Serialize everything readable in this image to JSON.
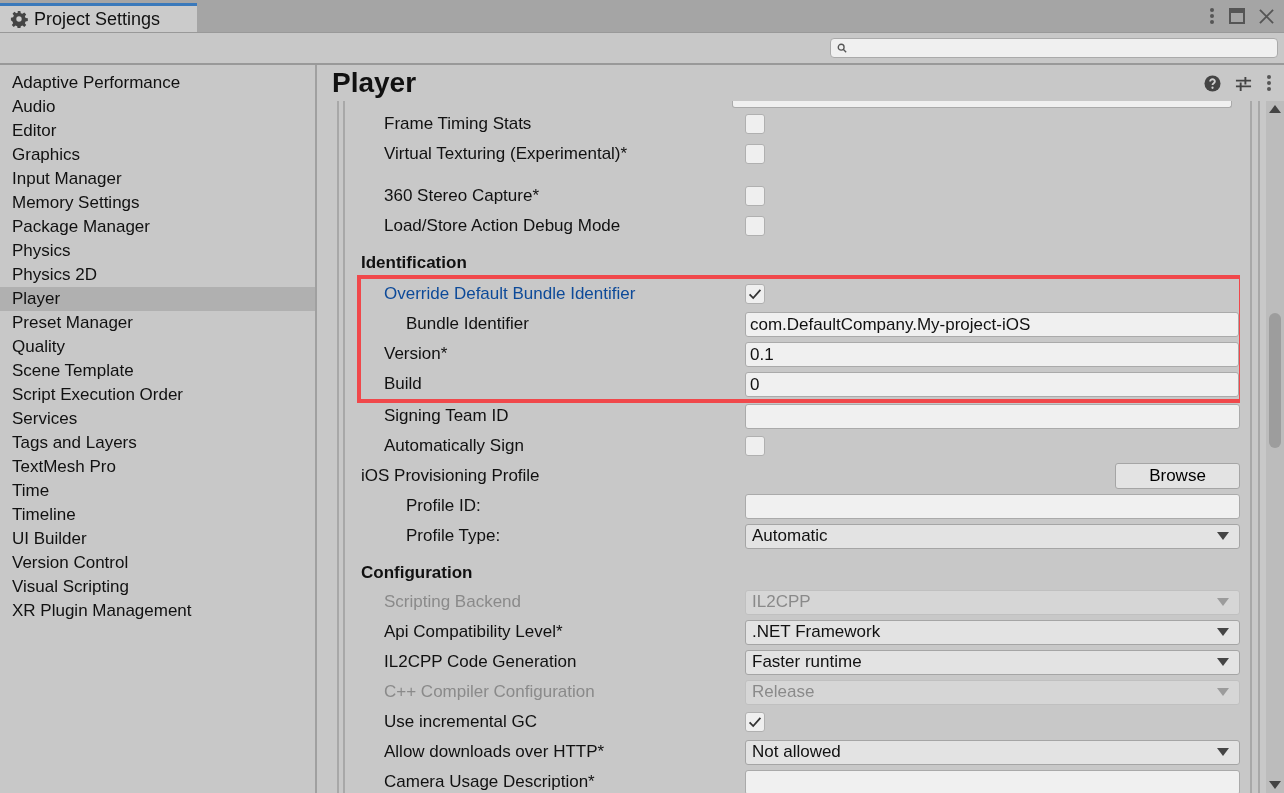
{
  "window": {
    "tab_title": "Project Settings"
  },
  "sidebar": {
    "items": [
      {
        "label": "Adaptive Performance",
        "selected": false
      },
      {
        "label": "Audio",
        "selected": false
      },
      {
        "label": "Editor",
        "selected": false
      },
      {
        "label": "Graphics",
        "selected": false
      },
      {
        "label": "Input Manager",
        "selected": false
      },
      {
        "label": "Memory Settings",
        "selected": false
      },
      {
        "label": "Package Manager",
        "selected": false
      },
      {
        "label": "Physics",
        "selected": false
      },
      {
        "label": "Physics 2D",
        "selected": false
      },
      {
        "label": "Player",
        "selected": true
      },
      {
        "label": "Preset Manager",
        "selected": false
      },
      {
        "label": "Quality",
        "selected": false
      },
      {
        "label": "Scene Template",
        "selected": false
      },
      {
        "label": "Script Execution Order",
        "selected": false
      },
      {
        "label": "Services",
        "selected": false
      },
      {
        "label": "Tags and Layers",
        "selected": false
      },
      {
        "label": "TextMesh Pro",
        "selected": false
      },
      {
        "label": "Time",
        "selected": false
      },
      {
        "label": "Timeline",
        "selected": false
      },
      {
        "label": "UI Builder",
        "selected": false
      },
      {
        "label": "Version Control",
        "selected": false
      },
      {
        "label": "Visual Scripting",
        "selected": false
      },
      {
        "label": "XR Plugin Management",
        "selected": false
      }
    ]
  },
  "panel": {
    "title": "Player",
    "rows": [
      {
        "kind": "checkbox",
        "label": "Frame Timing Stats",
        "checked": false
      },
      {
        "kind": "checkbox",
        "label": "Virtual Texturing (Experimental)*",
        "checked": false
      },
      {
        "kind": "spacer"
      },
      {
        "kind": "checkbox",
        "label": "360 Stereo Capture*",
        "checked": false
      },
      {
        "kind": "checkbox",
        "label": "Load/Store Action Debug Mode",
        "checked": false
      },
      {
        "kind": "header",
        "label": "Identification"
      },
      {
        "kind": "highlight",
        "children": [
          {
            "kind": "checkbox",
            "label": "Override Default Bundle Identifier",
            "checked": true,
            "children": [
              {
                "kind": "text",
                "label": "Bundle Identifier",
                "value": "com.DefaultCompany.My-project-iOS"
              }
            ]
          },
          {
            "kind": "text",
            "label": "Version*",
            "value": "0.1"
          },
          {
            "kind": "text",
            "label": "Build",
            "value": "0"
          }
        ]
      },
      {
        "kind": "text",
        "label": "Signing Team ID"
      },
      {
        "kind": "checkbox",
        "label": "Automatically Sign",
        "checked": false
      },
      {
        "kind": "button",
        "label": "iOS Provisioning Profile",
        "button": "Browse",
        "children": [
          {
            "kind": "text",
            "label": "Profile ID:"
          },
          {
            "kind": "dropdown",
            "label": "Profile Type:",
            "value": "Automatic",
            "disabled": false
          }
        ]
      },
      {
        "kind": "header",
        "label": "Configuration"
      },
      {
        "kind": "dropdown",
        "label": "Scripting Backend",
        "value": "IL2CPP",
        "disabled": true
      },
      {
        "kind": "dropdown",
        "label": "Api Compatibility Level*",
        "value": ".NET Framework",
        "disabled": false
      },
      {
        "kind": "dropdown",
        "label": "IL2CPP Code Generation",
        "value": "Faster runtime",
        "disabled": false
      },
      {
        "kind": "dropdown",
        "label": "C++ Compiler Configuration",
        "value": "Release",
        "disabled": true
      },
      {
        "kind": "checkbox",
        "label": "Use incremental GC",
        "checked": true
      },
      {
        "kind": "dropdown",
        "label": "Allow downloads over HTTP*",
        "value": "Not allowed",
        "disabled": false
      },
      {
        "kind": "text",
        "label": "Camera Usage Description*"
      }
    ]
  }
}
